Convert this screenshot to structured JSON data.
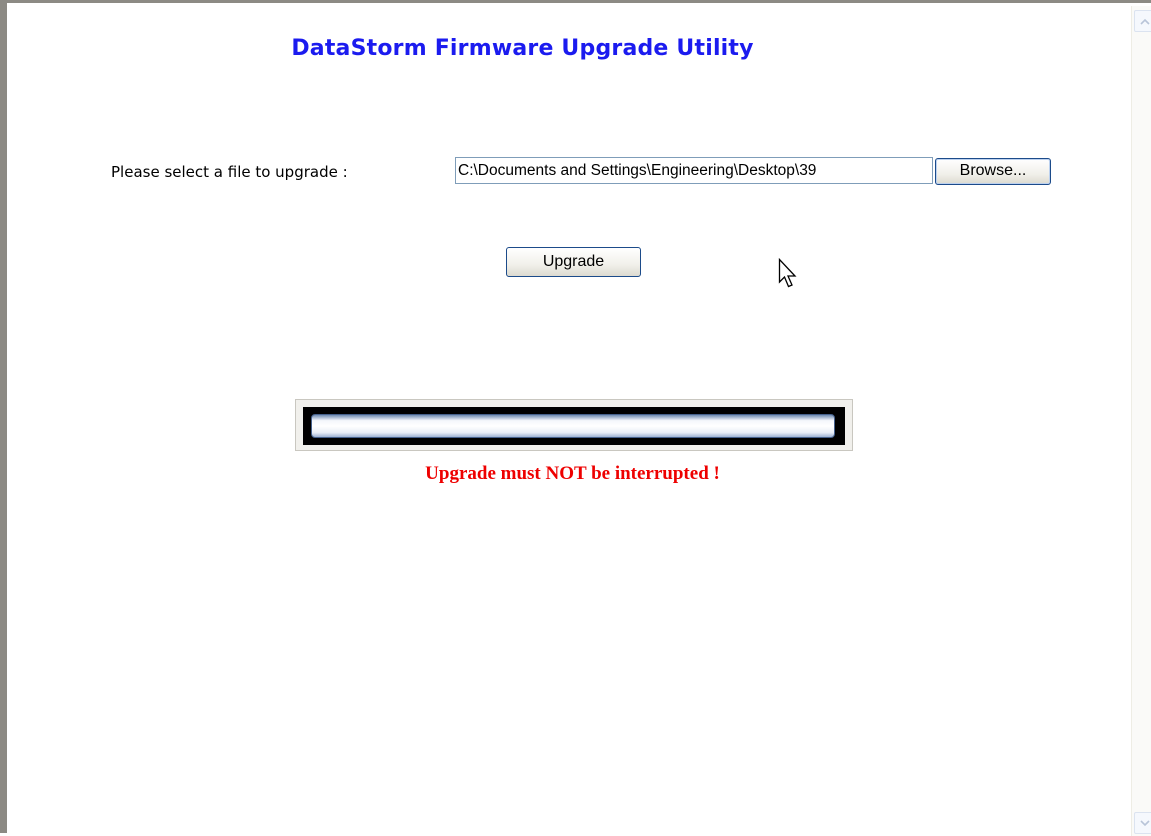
{
  "title": "DataStorm Firmware Upgrade Utility",
  "file_select": {
    "label": "Please select a file to upgrade :",
    "value": "C:\\Documents and Settings\\Engineering\\Desktop\\39",
    "browse_label": "Browse..."
  },
  "upgrade_button": "Upgrade",
  "progress": {
    "fraction": 0
  },
  "warning": "Upgrade must NOT be interrupted !",
  "colors": {
    "title": "#1b1bef",
    "warning": "#ee0000",
    "progress_fill": "#1b3fa0"
  },
  "icons": {
    "scroll_up": "chevron-up-icon",
    "scroll_down": "chevron-down-icon",
    "cursor": "mouse-pointer-icon"
  }
}
